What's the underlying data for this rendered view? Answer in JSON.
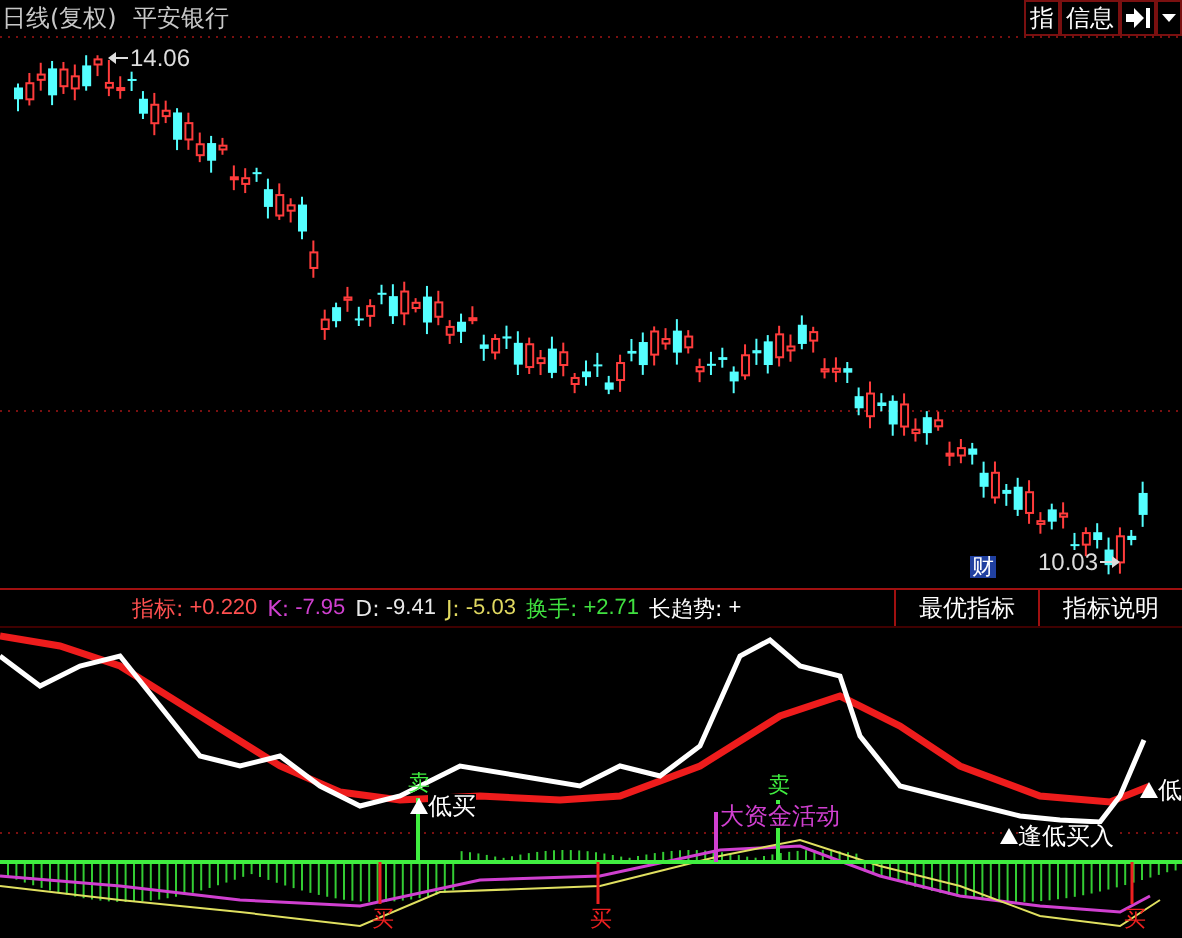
{
  "header": {
    "period": "日线(复权)",
    "stock": "平安银行"
  },
  "toolbar": [
    {
      "kind": "text",
      "label": "指"
    },
    {
      "kind": "text",
      "label": "信息"
    },
    {
      "kind": "icon"
    },
    {
      "kind": "caret"
    }
  ],
  "price_chart": {
    "high_label": "14.06",
    "low_label": "10.03",
    "event_marker": "财"
  },
  "indicator_readouts": [
    {
      "label": "指标:",
      "value": "+0.220",
      "color": "#ff5050"
    },
    {
      "label": "K:",
      "value": "-7.95",
      "color": "#d040d0"
    },
    {
      "label": "D:",
      "value": "-9.41",
      "color": "#e8e8e8"
    },
    {
      "label": "J:",
      "value": "-5.03",
      "color": "#e0d860"
    },
    {
      "label": "换手:",
      "value": "+2.71",
      "color": "#40e040"
    },
    {
      "label": "长趋势:",
      "value": "+",
      "color": "#ffffff"
    }
  ],
  "indicator_buttons": [
    "最优指标",
    "指标说明"
  ],
  "signals": [
    {
      "kind": "sell",
      "text": "卖"
    },
    {
      "kind": "up",
      "text": "低买"
    },
    {
      "kind": "fund",
      "text": "大资金活动"
    },
    {
      "kind": "sell",
      "text": "卖"
    },
    {
      "kind": "up",
      "text": "逢低买入"
    },
    {
      "kind": "up",
      "text": "低"
    },
    {
      "kind": "buy",
      "text": "买"
    },
    {
      "kind": "buy",
      "text": "买"
    },
    {
      "kind": "buy",
      "text": "买"
    }
  ]
}
